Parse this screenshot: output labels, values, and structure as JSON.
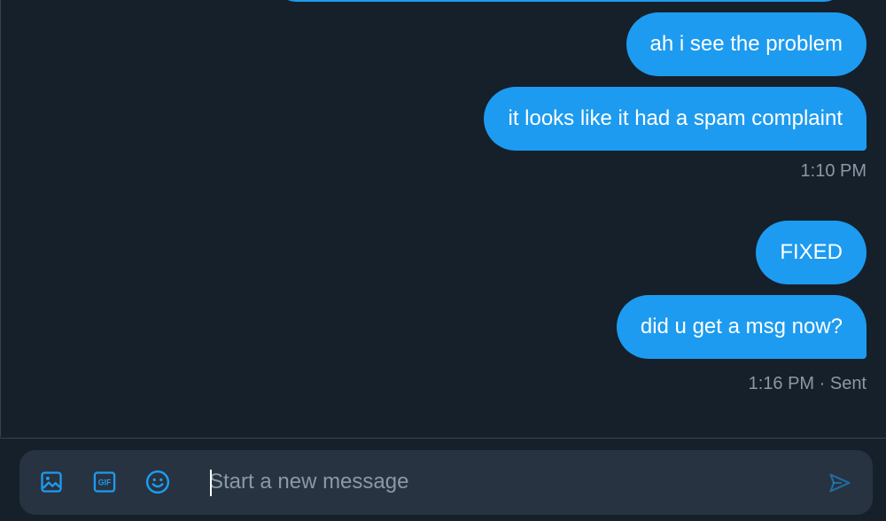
{
  "conversation": {
    "messages": [
      {
        "text": "ah i see the problem",
        "direction": "sent"
      },
      {
        "text": "it looks like it had a spam complaint",
        "direction": "sent"
      },
      {
        "text": "FIXED",
        "direction": "sent"
      },
      {
        "text": "did u get a msg now?",
        "direction": "sent"
      }
    ],
    "timestamps": [
      {
        "text": "1:10 PM"
      },
      {
        "text": "1:16 PM · Sent"
      }
    ]
  },
  "composer": {
    "placeholder": "Start a new message",
    "value": "",
    "icons": {
      "media": "image-icon",
      "gif": "gif-icon",
      "emoji": "emoji-icon",
      "send": "send-icon"
    },
    "gif_badge_text": "GIF"
  },
  "colors": {
    "background": "#15202b",
    "bubble": "#1d9bf0",
    "composer_bg": "#273340",
    "accent": "#1d9bf0",
    "muted_text": "#8b98a5",
    "border": "#38444d"
  }
}
